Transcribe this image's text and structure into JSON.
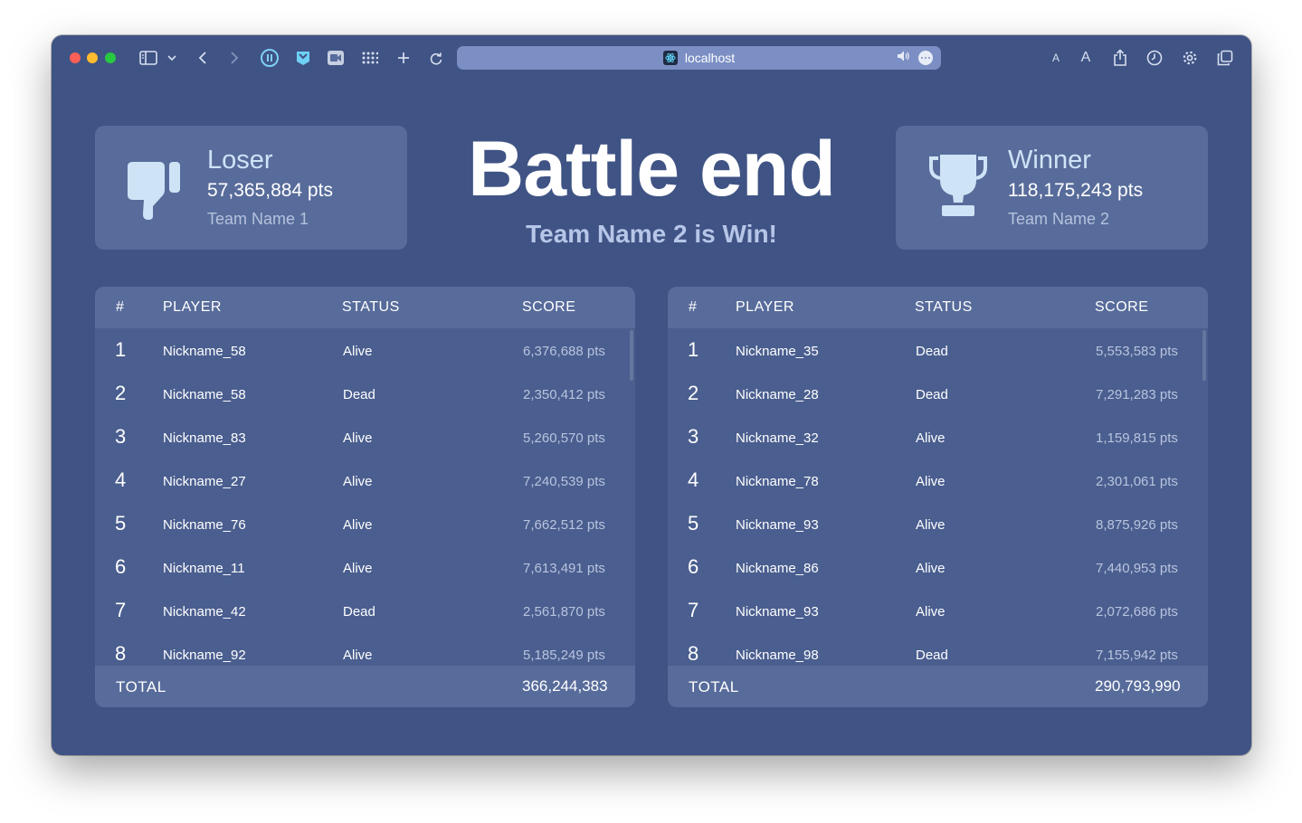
{
  "browser": {
    "url": "localhost",
    "icons": [
      "sidebar-icon",
      "chevron-down-icon",
      "back-icon",
      "forward-icon",
      "pause-icon",
      "extension-icon",
      "video-icon",
      "grid-icon",
      "new-tab-icon",
      "reload-icon",
      "speaker-icon",
      "more-icon",
      "text-smaller-icon",
      "text-larger-icon",
      "share-icon",
      "history-icon",
      "settings-icon",
      "tabs-icon"
    ]
  },
  "header": {
    "title": "Battle end",
    "subtitle": "Team Name 2 is Win!"
  },
  "loser": {
    "label": "Loser",
    "points": "57,365,884 pts",
    "team": "Team Name 1",
    "icon": "thumbs-down-icon"
  },
  "winner": {
    "label": "Winner",
    "points": "118,175,243 pts",
    "team": "Team Name 2",
    "icon": "trophy-icon"
  },
  "columns": {
    "num": "#",
    "player": "PLAYER",
    "status": "STATUS",
    "score": "SCORE"
  },
  "colors": {
    "background": "#3f5384",
    "card": "#586c9b",
    "panel": "#4a5e8f",
    "icon": "#cfe3f7"
  },
  "teams": [
    {
      "rows": [
        {
          "rank": "1",
          "player": "Nickname_58",
          "status": "Alive",
          "score": "6,376,688 pts"
        },
        {
          "rank": "2",
          "player": "Nickname_58",
          "status": "Dead",
          "score": "2,350,412 pts"
        },
        {
          "rank": "3",
          "player": "Nickname_83",
          "status": "Alive",
          "score": "5,260,570 pts"
        },
        {
          "rank": "4",
          "player": "Nickname_27",
          "status": "Alive",
          "score": "7,240,539 pts"
        },
        {
          "rank": "5",
          "player": "Nickname_76",
          "status": "Alive",
          "score": "7,662,512 pts"
        },
        {
          "rank": "6",
          "player": "Nickname_11",
          "status": "Alive",
          "score": "7,613,491 pts"
        },
        {
          "rank": "7",
          "player": "Nickname_42",
          "status": "Dead",
          "score": "2,561,870 pts"
        },
        {
          "rank": "8",
          "player": "Nickname_92",
          "status": "Alive",
          "score": "5,185,249 pts"
        }
      ],
      "total_label": "TOTAL",
      "total": "366,244,383"
    },
    {
      "rows": [
        {
          "rank": "1",
          "player": "Nickname_35",
          "status": "Dead",
          "score": "5,553,583 pts"
        },
        {
          "rank": "2",
          "player": "Nickname_28",
          "status": "Dead",
          "score": "7,291,283 pts"
        },
        {
          "rank": "3",
          "player": "Nickname_32",
          "status": "Alive",
          "score": "1,159,815 pts"
        },
        {
          "rank": "4",
          "player": "Nickname_78",
          "status": "Alive",
          "score": "2,301,061 pts"
        },
        {
          "rank": "5",
          "player": "Nickname_93",
          "status": "Alive",
          "score": "8,875,926 pts"
        },
        {
          "rank": "6",
          "player": "Nickname_86",
          "status": "Alive",
          "score": "7,440,953 pts"
        },
        {
          "rank": "7",
          "player": "Nickname_93",
          "status": "Alive",
          "score": "2,072,686 pts"
        },
        {
          "rank": "8",
          "player": "Nickname_98",
          "status": "Dead",
          "score": "7,155,942 pts"
        }
      ],
      "total_label": "TOTAL",
      "total": "290,793,990"
    }
  ]
}
